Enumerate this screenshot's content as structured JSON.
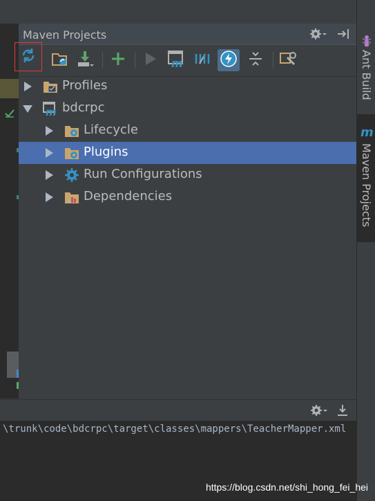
{
  "panel": {
    "title": "Maven Projects"
  },
  "toolbar": {
    "buttons": [
      {
        "icon": "reimport-icon"
      },
      {
        "icon": "generate-sources-icon"
      },
      {
        "icon": "download-icon"
      },
      {
        "icon": "add-icon"
      },
      {
        "icon": "run-icon"
      },
      {
        "icon": "execute-goal-icon"
      },
      {
        "icon": "toggle-offline-icon"
      },
      {
        "icon": "skip-tests-icon"
      },
      {
        "icon": "collapse-all-icon"
      },
      {
        "icon": "settings-icon"
      }
    ]
  },
  "tree": {
    "items": [
      {
        "label": "Profiles",
        "expanded": false,
        "level": 0
      },
      {
        "label": "bdcrpc",
        "expanded": true,
        "level": 0
      },
      {
        "label": "Lifecycle",
        "expanded": false,
        "level": 1
      },
      {
        "label": "Plugins",
        "expanded": false,
        "level": 1,
        "selected": true
      },
      {
        "label": "Run Configurations",
        "expanded": false,
        "level": 1
      },
      {
        "label": "Dependencies",
        "expanded": false,
        "level": 1
      }
    ]
  },
  "right_tabs": [
    {
      "label": "Ant Build"
    },
    {
      "label": "Maven Projects"
    }
  ],
  "console": {
    "line": "\\trunk\\code\\bdcrpc\\target\\classes\\mappers\\TeacherMapper.xml"
  },
  "watermark": "https://blog.csdn.net/shi_hong_fei_hei",
  "colors": {
    "selection": "#4b6eaf",
    "highlight_box": "#e0393e",
    "add_green": "#59a869",
    "offline_blue": "#3592c4"
  }
}
